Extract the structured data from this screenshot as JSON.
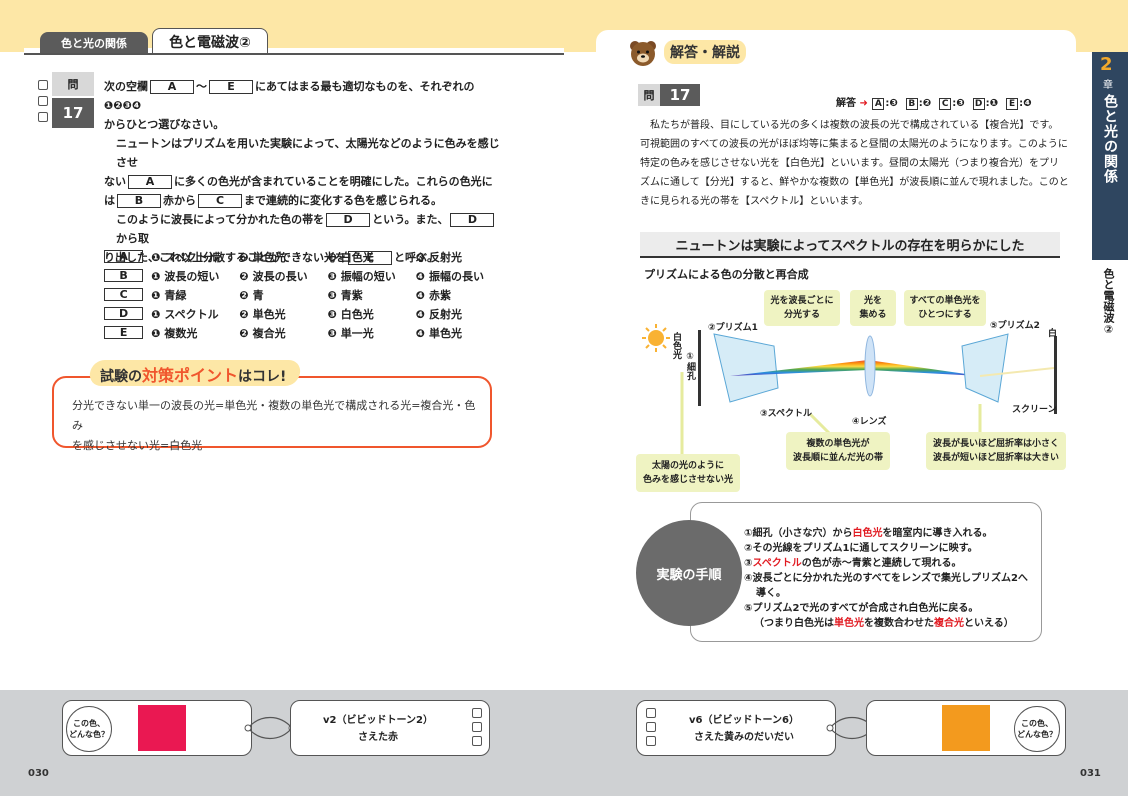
{
  "left": {
    "tab_label": "色と光の関係",
    "title": "色と電磁波②",
    "q_label": "問",
    "q_number": "17",
    "question_lines": [
      "次の空欄",
      "にあてはまる最も適切なものを、それぞれの❶❷❸❹",
      "からひとつ選びなさい。"
    ],
    "tilde": "〜",
    "para1": {
      "l1": "ニュートンはプリズムを用いた実験によって、太陽光などのように色みを感じさせ",
      "l2a": "ない",
      "l2b": "に多くの色光が含まれていることを明確にした。これらの色光に",
      "l3a": "は",
      "l3b": "赤から",
      "l3c": "まで連続的に変化する色を感じられる。"
    },
    "para2": {
      "l1a": "このように波長によって分かれた色の帯を",
      "l1b": "という。また、",
      "l1c": "から取",
      "l2a": "り出した、これ以上分散することができない光を",
      "l2b": "と呼ぶ。"
    },
    "keys": [
      "A",
      "B",
      "C",
      "D",
      "E"
    ],
    "choices": [
      {
        "key": "A",
        "opts": [
          "❶ スペクトル",
          "❷ 単色光",
          "❸ 白色光",
          "❹ 反射光"
        ]
      },
      {
        "key": "B",
        "opts": [
          "❶ 波長の短い",
          "❷ 波長の長い",
          "❸ 振幅の短い",
          "❹ 振幅の長い"
        ]
      },
      {
        "key": "C",
        "opts": [
          "❶ 青緑",
          "❷ 青",
          "❸ 青紫",
          "❹ 赤紫"
        ]
      },
      {
        "key": "D",
        "opts": [
          "❶ スペクトル",
          "❷ 単色光",
          "❸ 白色光",
          "❹ 反射光"
        ]
      },
      {
        "key": "E",
        "opts": [
          "❶ 複数光",
          "❷ 複合光",
          "❸ 単一光",
          "❹ 単色光"
        ]
      }
    ],
    "point_title_a": "試験の",
    "point_title_b": "対策ポイント",
    "point_title_c": "はコレ!",
    "point_body_l1": "分光できない単一の波長の光=単色光・複数の単色光で構成される光=複合光・色み",
    "point_body_l2": "を感じさせない光=白色光"
  },
  "right": {
    "answer_title": "解答・解説",
    "q_label": "問",
    "q_number": "17",
    "answer_label": "解答",
    "answers": [
      {
        "key": "A",
        "val": "❸"
      },
      {
        "key": "B",
        "val": "❷"
      },
      {
        "key": "C",
        "val": "❸"
      },
      {
        "key": "D",
        "val": "❶"
      },
      {
        "key": "E",
        "val": "❹"
      }
    ],
    "explanation": [
      "私たちが普段、目にしている光の多くは複数の波長の光で構成されている【複合光】です。",
      "可視範囲のすべての波長の光がほぼ均等に集まると昼間の太陽光のようになります。このように",
      "特定の色みを感じさせない光を【白色光】といいます。昼間の太陽光（つまり複合光）をプリ",
      "ズムに通して【分光】すると、鮮やかな複数の【単色光】が波長順に並んで現れました。このと",
      "きに見られる光の帯を【スペクトル】といいます。"
    ],
    "section_heading": "ニュートンは実験によってスペクトルの存在を明らかにした",
    "diagram_heading": "プリズムによる色の分散と再合成",
    "diagram": {
      "callout_split_l1": "光を波長ごとに",
      "callout_split_l2": "分光する",
      "callout_focus_l1": "光を",
      "callout_focus_l2": "集める",
      "callout_merge_l1": "すべての単色光を",
      "callout_merge_l2": "ひとつにする",
      "prism1": "②プリズム1",
      "prism2": "⑤プリズム2",
      "white_light": "白色光",
      "slit": "①細孔",
      "white": "白",
      "spectrum": "③スペクトル",
      "lens": "④レンズ",
      "screen": "スクリーン",
      "callout_sun_l1": "太陽の光のように",
      "callout_sun_l2": "色みを感じさせない光",
      "callout_band_l1": "複数の単色光が",
      "callout_band_l2": "波長順に並んだ光の帯",
      "callout_refr_l1": "波長が長いほど屈折率は小さく",
      "callout_refr_l2": "波長が短いほど屈折率は大きい"
    },
    "steps_title": "実験の手順",
    "steps": {
      "s1a": "①細孔（小さな穴）から",
      "s1b": "白色光",
      "s1c": "を暗室内に導き入れる。",
      "s2": "②その光線をプリズム1に通してスクリーンに映す。",
      "s3a": "③",
      "s3b": "スペクトル",
      "s3c": "の色が赤〜青紫と連続して現れる。",
      "s4a": "④波長ごとに分かれた光のすべてをレンズで集光しプリズム2へ",
      "s4b": "導く。",
      "s5": "⑤プリズム2で光のすべてが合成され白色光に戻る。",
      "s6a": "（つまり白色光は",
      "s6b": "単色光",
      "s6c": "を複数合わせた",
      "s6d": "複合光",
      "s6e": "といえる）"
    },
    "chapter_number": "2",
    "chapter_word": "章",
    "chapter_title": "色と光の関係",
    "chapter_sub": "色と電磁波②"
  },
  "bottom": {
    "quiz_bubble_l1": "この色、",
    "quiz_bubble_l2": "どんな色？",
    "left_tone_name": "v2（ビビッドトーン2）",
    "left_tone_desc": "さえた赤",
    "left_swatch_color": "#ea1852",
    "right_tone_name": "v6（ビビッドトーン6）",
    "right_tone_desc": "さえた黄みのだいだい",
    "right_swatch_color": "#f39a1e",
    "page_left": "030",
    "page_right": "031"
  },
  "colors": {
    "accent_yellow": "#fde7a6",
    "accent_orange": "#f0562d",
    "chapter_navy": "#2f4660"
  }
}
